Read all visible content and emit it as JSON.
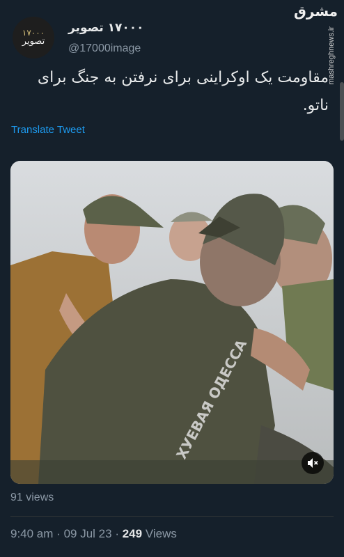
{
  "author": {
    "display_name": "۱۷۰۰۰ تصویر",
    "handle": "@17000image",
    "avatar_line1": "۱۷۰۰۰",
    "avatar_line2": "تصویر"
  },
  "watermark": {
    "logo": "مشرق",
    "url": "mashreghnews.ir"
  },
  "tweet": {
    "text": "مقاومت یک اوکراینی برای نرفتن به جنگ برای ناتو.",
    "translate_label": "Translate Tweet"
  },
  "media": {
    "overlay_text": "ХУЕВАЯ ОДЕССА",
    "mute_icon": "mute-icon"
  },
  "stats": {
    "video_views": "91 views",
    "time": "9:40 am",
    "separator": "·",
    "date": "09 Jul 23",
    "view_count": "249",
    "view_label": "Views"
  }
}
